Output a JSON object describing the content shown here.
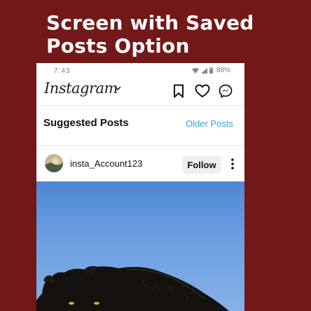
{
  "headline": {
    "line1": "Screen with Saved",
    "line2": "Posts Option"
  },
  "status_bar": {
    "time": "7:43",
    "battery": "88%"
  },
  "app_bar": {
    "logo": "Instagram",
    "icons": [
      "chevron-down-icon",
      "bookmark-icon",
      "heart-icon",
      "messenger-icon"
    ]
  },
  "section": {
    "title": "Suggested Posts",
    "link": "Older Posts"
  },
  "post": {
    "username": "insta_Account123",
    "follow_label": "Follow"
  },
  "colors": {
    "background": "#731818",
    "link": "#2fa8d8",
    "sky": "#6a9ce0"
  }
}
